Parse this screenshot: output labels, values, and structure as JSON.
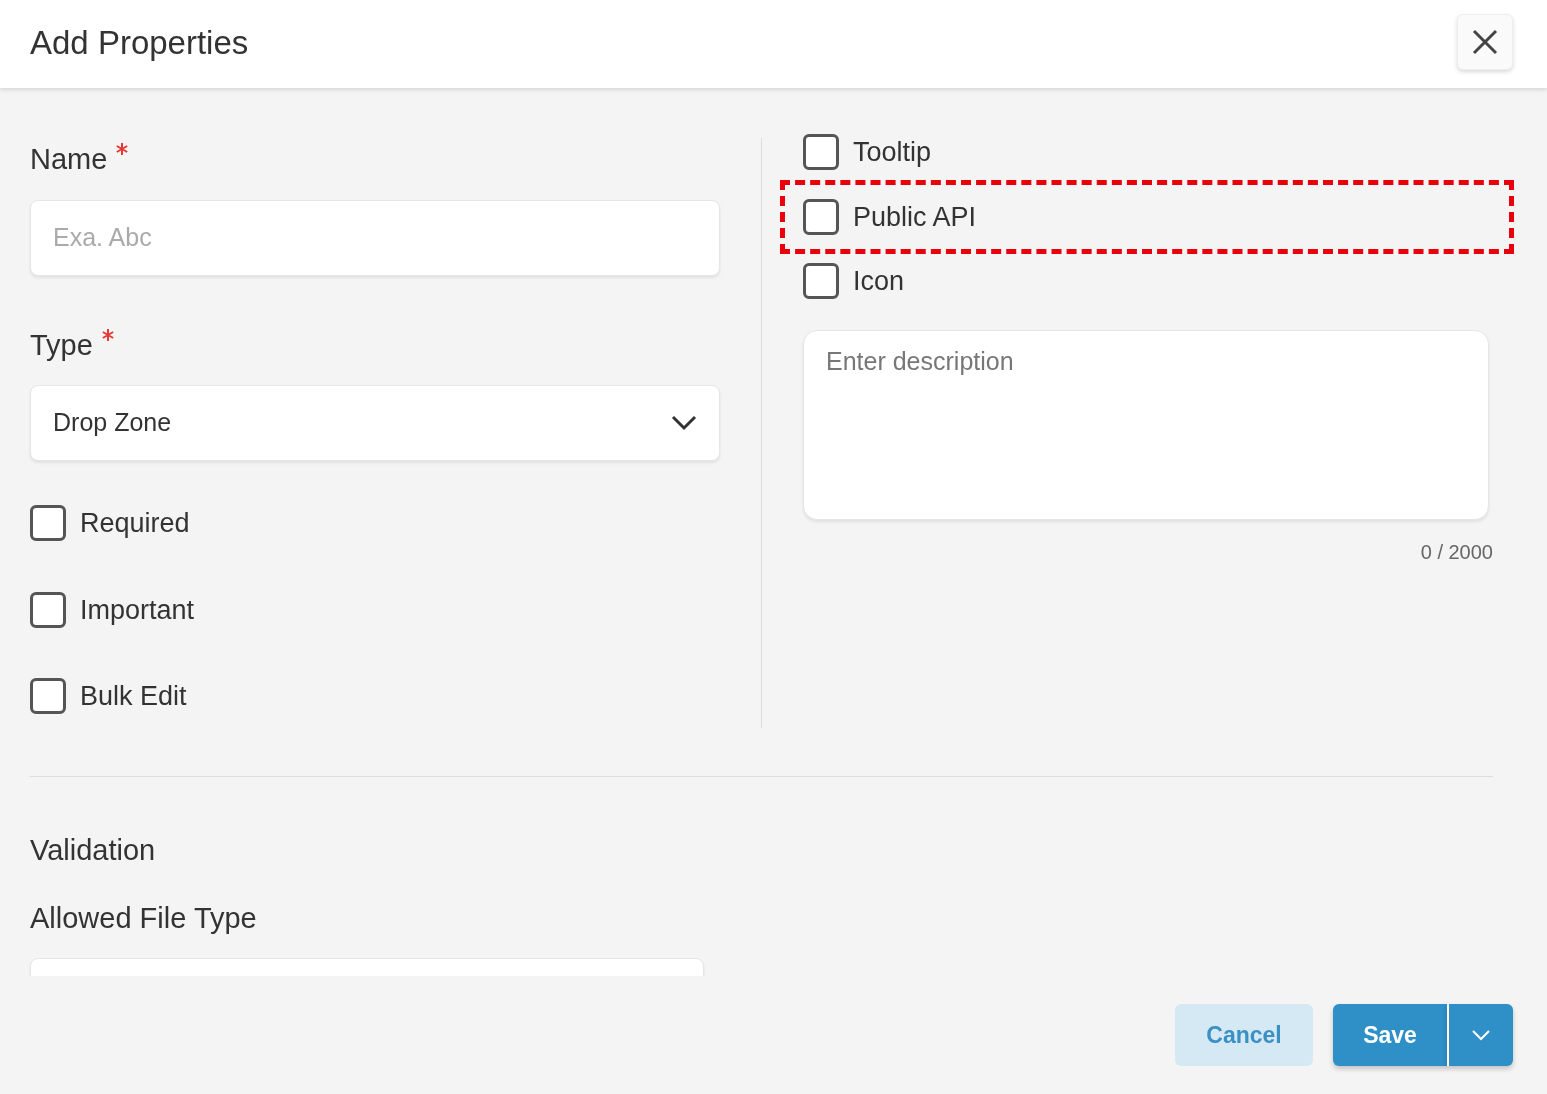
{
  "dialog": {
    "title": "Add Properties"
  },
  "fields": [
    {
      "kind": "text",
      "label": "Name",
      "required": true,
      "placeholder": "Exa. Abc"
    },
    {
      "kind": "select",
      "label": "Type",
      "required": true,
      "value": "Drop Zone"
    }
  ],
  "left_checkboxes": [
    {
      "label": "Required",
      "checked": false
    },
    {
      "label": "Important",
      "checked": false
    },
    {
      "label": "Bulk Edit",
      "checked": false
    }
  ],
  "right_checkboxes": [
    {
      "label": "Tooltip",
      "checked": false,
      "highlighted": false
    },
    {
      "label": "Public API",
      "checked": false,
      "highlighted": true
    },
    {
      "label": "Icon",
      "checked": false,
      "highlighted": false
    }
  ],
  "description": {
    "placeholder": "Enter description",
    "counter": "0 / 2000"
  },
  "validation": {
    "title": "Validation",
    "field_label": "Allowed File Type"
  },
  "buttons": {
    "cancel": "Cancel",
    "save": "Save"
  }
}
